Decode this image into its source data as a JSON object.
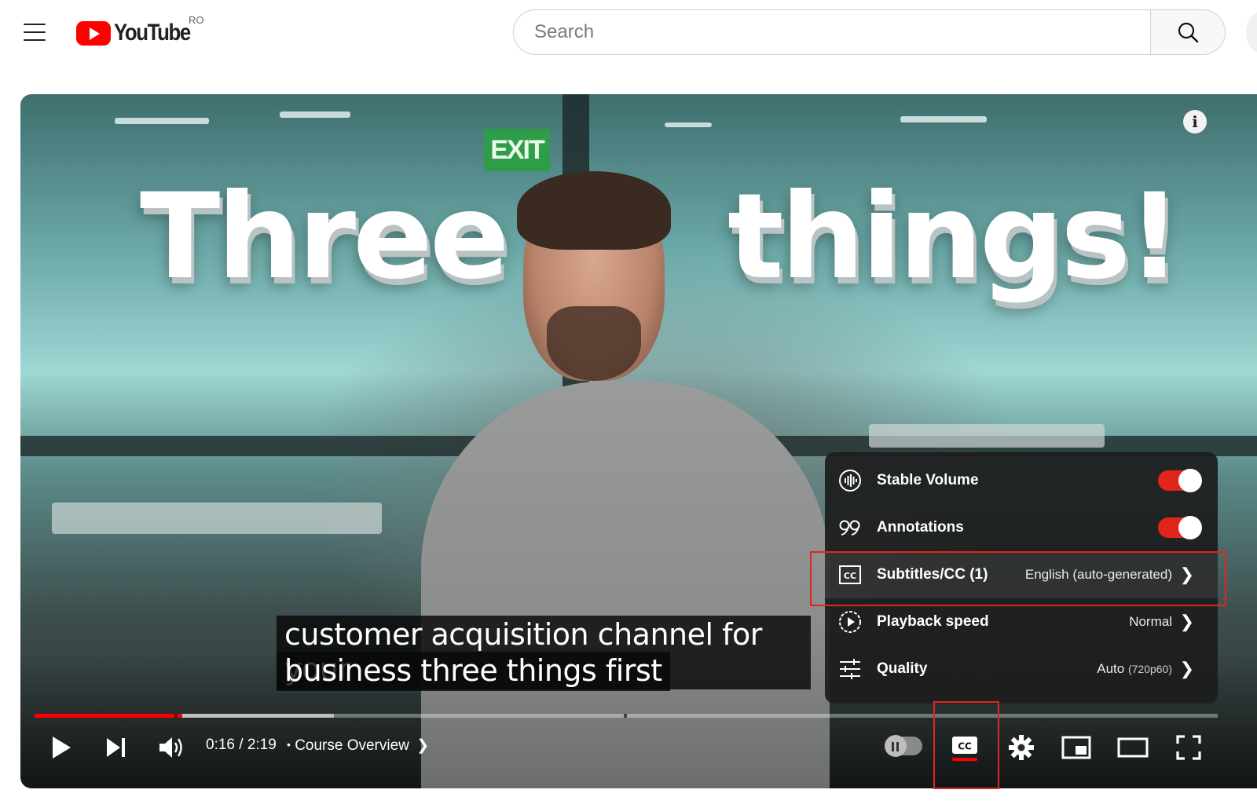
{
  "header": {
    "logo_text": "YouTube",
    "country_code": "RO",
    "search_placeholder": "Search"
  },
  "video": {
    "overlay_words": [
      "Three",
      "things!"
    ],
    "exit_sign": "EXIT",
    "info_label": "i"
  },
  "captions": {
    "line1": "customer acquisition channel for your",
    "line2": "business three things first"
  },
  "settings_menu": {
    "items": [
      {
        "label": "Stable Volume",
        "toggle": true
      },
      {
        "label": "Annotations",
        "toggle": true
      },
      {
        "label": "Subtitles/CC (1)",
        "value": "English (auto-generated)"
      },
      {
        "label": "Playback speed",
        "value": "Normal"
      },
      {
        "label": "Quality",
        "value_main": "Auto",
        "value_sub": "(720p60)"
      }
    ]
  },
  "controls": {
    "time": "0:16 / 2:19",
    "separator": "•",
    "chapter": "Course Overview",
    "progress_played_fraction": 0.125,
    "progress_buffered_fraction": 0.253
  },
  "colors": {
    "accent": "#ff0000",
    "highlight": "#e0261e",
    "menu_bg": "#1c1c1c"
  }
}
